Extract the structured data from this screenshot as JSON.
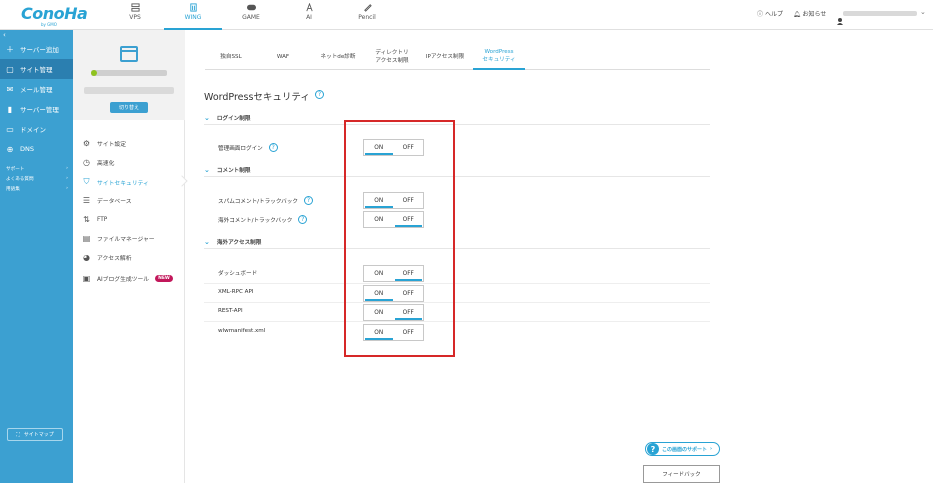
{
  "brand": {
    "logo_text": "ConoHa",
    "logo_sub": "by GMO"
  },
  "top_nav": [
    {
      "label": "VPS",
      "icon": "server-icon"
    },
    {
      "label": "WING",
      "icon": "building-icon",
      "active": true
    },
    {
      "label": "GAME",
      "icon": "gamepad-icon"
    },
    {
      "label": "AI",
      "icon": "ai-icon"
    },
    {
      "label": "Pencil",
      "icon": "pencil-icon"
    }
  ],
  "header": {
    "help_label": "ヘルプ",
    "notice_label": "お知らせ"
  },
  "sidebar": {
    "items": [
      {
        "label": "サーバー追加",
        "icon": "plus-icon"
      },
      {
        "label": "サイト管理",
        "icon": "browser-icon",
        "active": true
      },
      {
        "label": "メール管理",
        "icon": "mail-icon"
      },
      {
        "label": "サーバー管理",
        "icon": "chart-icon"
      },
      {
        "label": "ドメイン",
        "icon": "tag-icon"
      },
      {
        "label": "DNS",
        "icon": "globe-icon"
      }
    ],
    "links": [
      {
        "label": "サポート"
      },
      {
        "label": "よくある質問"
      },
      {
        "label": "用語集"
      }
    ],
    "sitemap_label": "サイトマップ"
  },
  "site_panel": {
    "switch_label": "切り替え",
    "menu": [
      {
        "label": "サイト設定",
        "icon": "site-settings-icon"
      },
      {
        "label": "高速化",
        "icon": "speed-icon"
      },
      {
        "label": "サイトセキュリティ",
        "icon": "shield-icon",
        "active": true
      },
      {
        "label": "データベース",
        "icon": "database-icon"
      },
      {
        "label": "FTP",
        "icon": "ftp-icon"
      },
      {
        "label": "ファイルマネージャー",
        "icon": "folder-icon"
      },
      {
        "label": "アクセス解析",
        "icon": "pie-icon"
      },
      {
        "label": "AIブログ生成ツール",
        "icon": "ai-doc-icon",
        "badge": "NEW"
      }
    ]
  },
  "tabs": [
    {
      "line1": "独自SSL",
      "line2": ""
    },
    {
      "line1": "WAF",
      "line2": ""
    },
    {
      "line1": "ネットde診断",
      "line2": ""
    },
    {
      "line1": "ディレクトリ",
      "line2": "アクセス制限"
    },
    {
      "line1": "IPアクセス制限",
      "line2": ""
    },
    {
      "line1": "WordPress",
      "line2": "セキュリティ",
      "active": true
    }
  ],
  "page": {
    "title": "WordPressセキュリティ",
    "sections": [
      {
        "title": "ログイン制限",
        "rows": [
          {
            "label": "管理画面ログイン",
            "help": true,
            "on": "ON",
            "off": "OFF",
            "state": "ON"
          }
        ]
      },
      {
        "title": "コメント制限",
        "rows": [
          {
            "label": "スパムコメント/トラックバック",
            "help": true,
            "on": "ON",
            "off": "OFF",
            "state": "ON"
          },
          {
            "label": "海外コメント/トラックバック",
            "help": true,
            "on": "ON",
            "off": "OFF",
            "state": "OFF"
          }
        ]
      },
      {
        "title": "海外アクセス制限",
        "rows": [
          {
            "label": "ダッシュボード",
            "help": false,
            "on": "ON",
            "off": "OFF",
            "state": "OFF"
          },
          {
            "label": "XML-RPC API",
            "help": false,
            "on": "ON",
            "off": "OFF",
            "state": "ON"
          },
          {
            "label": "REST-API",
            "help": false,
            "on": "ON",
            "off": "OFF",
            "state": "OFF"
          },
          {
            "label": "wlwmanifest.xml",
            "help": false,
            "on": "ON",
            "off": "OFF",
            "state": "ON"
          }
        ]
      }
    ]
  },
  "footer": {
    "support_label": "この画面のサポート",
    "feedback_label": "フィードバック"
  },
  "colors": {
    "accent": "#29a3d4",
    "sidebar": "#3ca0d1",
    "highlight": "#d62828",
    "badge": "#c2185b"
  }
}
